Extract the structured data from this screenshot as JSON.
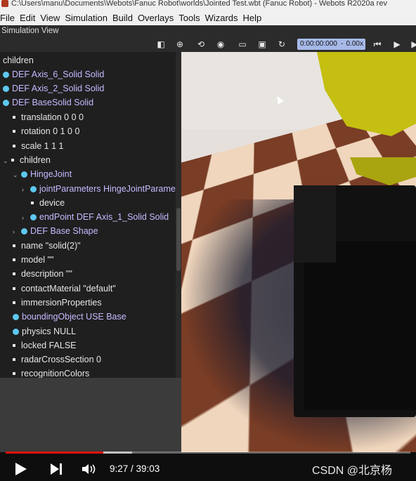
{
  "window_title": "C:\\Users\\manu\\Documents\\Webots\\Fanuc Robot\\worlds\\Jointed Test.wbt (Fanuc Robot) - Webots R2020a rev",
  "menu": [
    "File",
    "Edit",
    "View",
    "Simulation",
    "Build",
    "Overlays",
    "Tools",
    "Wizards",
    "Help"
  ],
  "panel_title": "Simulation View",
  "clock": {
    "time": "0:00:00:000",
    "sep": "-",
    "speed": "0.00x"
  },
  "tree": [
    {
      "label": "children",
      "kind": "text"
    },
    {
      "label": "DEF Axis_6_Solid Solid",
      "kind": "node"
    },
    {
      "label": "DEF Axis_2_Solid Solid",
      "kind": "node"
    },
    {
      "label": "DEF BaseSolid Solid",
      "kind": "node"
    },
    {
      "label": "translation 0 0 0",
      "kind": "field"
    },
    {
      "label": "rotation 0 1 0 0",
      "kind": "field"
    },
    {
      "label": "scale 1 1 1",
      "kind": "field"
    },
    {
      "label": "children",
      "kind": "field"
    },
    {
      "label": "HingeJoint",
      "kind": "node"
    },
    {
      "label": "jointParameters HingeJointParameters",
      "kind": "node"
    },
    {
      "label": "device",
      "kind": "field"
    },
    {
      "label": "endPoint DEF Axis_1_Solid Solid",
      "kind": "node"
    },
    {
      "label": "DEF Base Shape",
      "kind": "node"
    },
    {
      "label": "name \"solid(2)\"",
      "kind": "field"
    },
    {
      "label": "model \"\"",
      "kind": "field"
    },
    {
      "label": "description \"\"",
      "kind": "field"
    },
    {
      "label": "contactMaterial \"default\"",
      "kind": "field"
    },
    {
      "label": "immersionProperties",
      "kind": "field"
    },
    {
      "label": "boundingObject USE Base",
      "kind": "node"
    },
    {
      "label": "physics NULL",
      "kind": "node"
    },
    {
      "label": "locked FALSE",
      "kind": "field"
    },
    {
      "label": "radarCrossSection 0",
      "kind": "field"
    },
    {
      "label": "recognitionColors",
      "kind": "field"
    }
  ],
  "player": {
    "time": "9:27 / 39:03",
    "progress": 0.242
  },
  "watermark": "CSDN @北京杨",
  "colors": {
    "node_label": "#c8b8ff",
    "node_dot": "#5ec8f0",
    "progress": "#e01010",
    "clock_bg": "#a6b9e8"
  }
}
